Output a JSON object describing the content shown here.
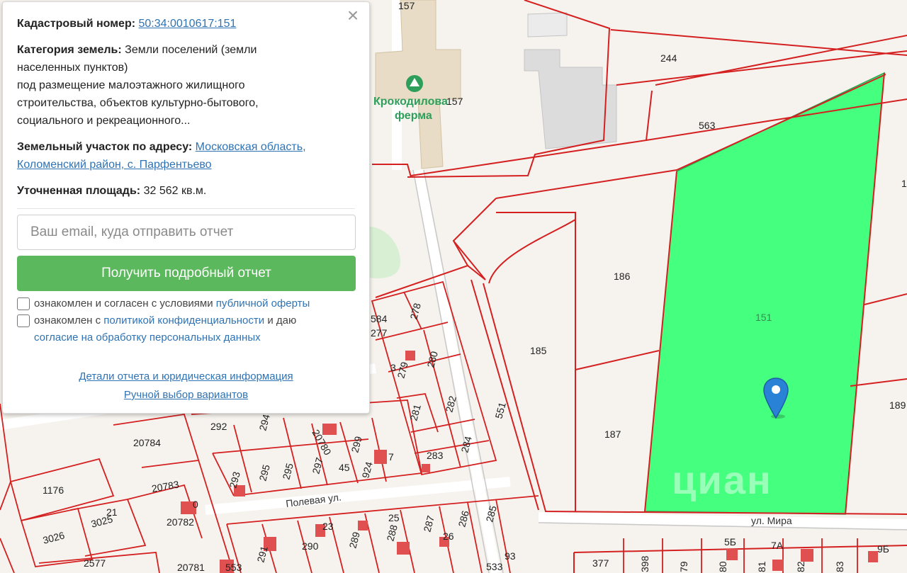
{
  "panel": {
    "cadastral_label": "Кадастровый номер:",
    "cadastral_number": "50:34:0010617:151",
    "category_label": "Категория земель:",
    "category_line1": "Земли поселений (земли",
    "category_line2": "населенных пунктов)",
    "category_line3": "под размещение малоэтажного жилищного",
    "category_line4": "строительства, объектов культурно-бытового,",
    "category_line5": "социального и рекреационного...",
    "address_label": "Земельный участок по адресу:",
    "address_line1": "Московская область,",
    "address_line2": "Коломенский район, с. Парфентьево",
    "area_label": "Уточненная площадь:",
    "area_value": "32 562 кв.м.",
    "email_placeholder": "Ваш email, куда отправить отчет",
    "report_button": "Получить подробный отчет",
    "check1_text": "ознакомлен и согласен с условиями",
    "check1_link": "публичной оферты",
    "check2_text_a": "ознакомлен с",
    "check2_link_a": "политикой конфиденциальности",
    "check2_text_b": "и даю",
    "check2_link_b": "согласие на обработку персональных данных",
    "details_link": "Детали отчета и юридическая информация",
    "manual_link": "Ручной выбор вариантов",
    "close_icon": "×"
  },
  "map": {
    "poi_name_line1": "Крокодилова",
    "poi_name_line2": "ферма",
    "street_1": "Полевая ул.",
    "street_2": "ул. Мира",
    "watermark": "циан",
    "parcels": [
      "157",
      "244",
      "157",
      "563",
      "1",
      "186",
      "151",
      "185",
      "189",
      "187",
      "551",
      "278",
      "584",
      "277",
      "280",
      "279",
      "3",
      "281",
      "282",
      "283",
      "284",
      "292",
      "294",
      "20780",
      "299",
      "924",
      "7",
      "293",
      "295",
      "295",
      "297",
      "45",
      "20784",
      "20783",
      "1176",
      "3026",
      "3025",
      "21",
      "20782",
      "0",
      "2577",
      "20781",
      "553",
      "291",
      "290",
      "289",
      "288",
      "287",
      "286",
      "285",
      "25",
      "26",
      "23",
      "93",
      "533",
      "377",
      "398",
      "79",
      "80",
      "81",
      "82",
      "83",
      "5Б",
      "7А",
      "9Б"
    ],
    "colors": {
      "highlight": "#45ff7e",
      "boundary": "#d42020",
      "building": "#e05050"
    },
    "icons": [
      "map-marker-icon",
      "crocodile-farm-icon",
      "close-icon"
    ]
  }
}
